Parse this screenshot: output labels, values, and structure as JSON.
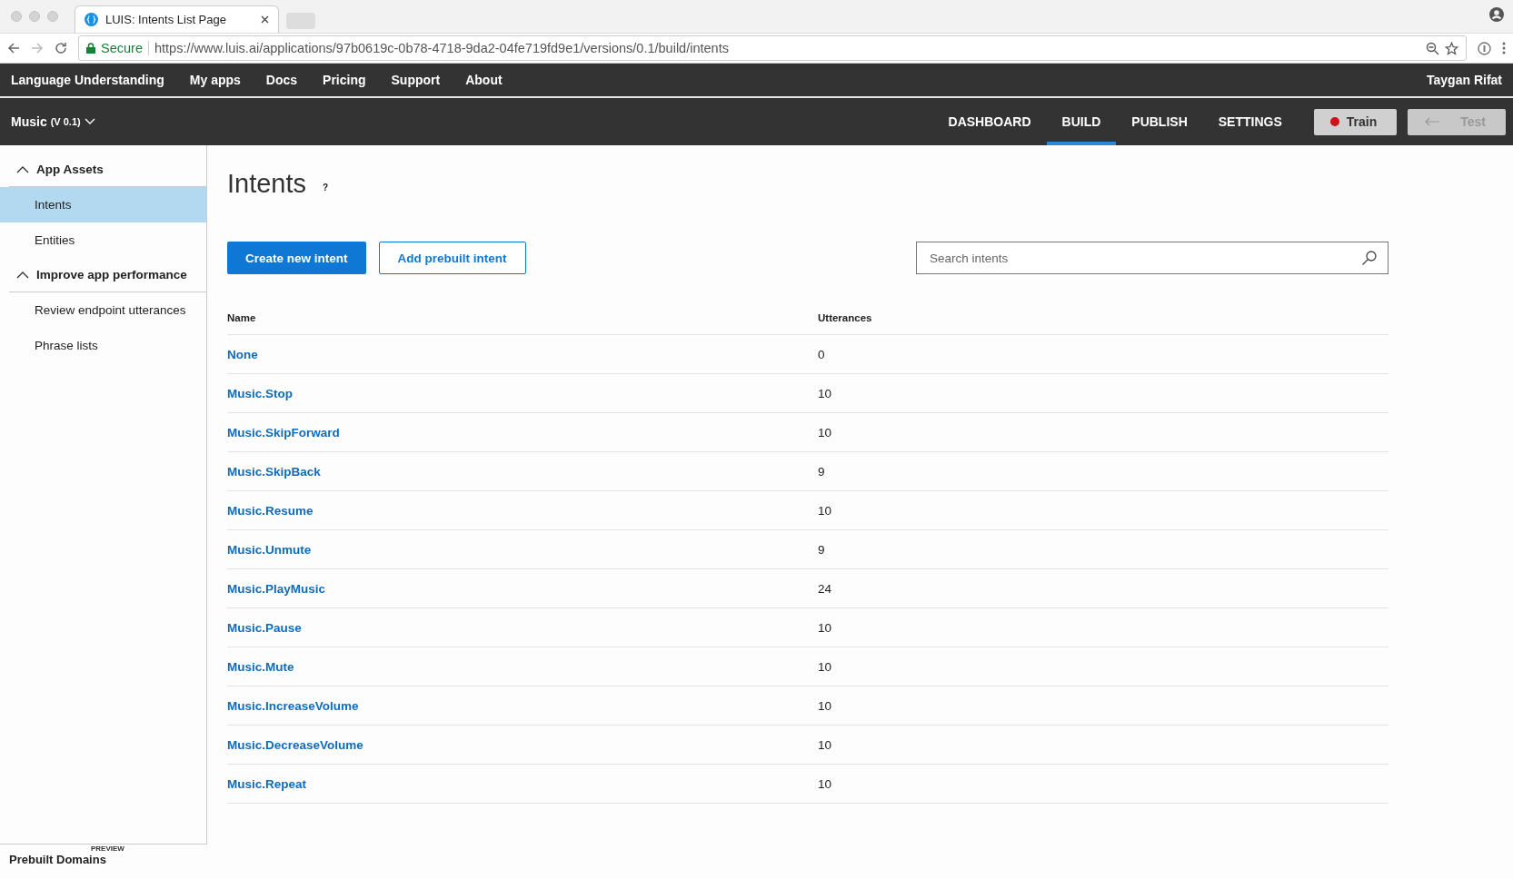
{
  "browser": {
    "tab_title": "LUIS: Intents List Page",
    "secure_label": "Secure",
    "url": "https://www.luis.ai/applications/97b0619c-0b78-4718-9da2-04fe719fd9e1/versions/0.1/build/intents"
  },
  "top_nav": {
    "items": [
      "Language Understanding",
      "My apps",
      "Docs",
      "Pricing",
      "Support",
      "About"
    ],
    "user": "Taygan Rifat"
  },
  "app_bar": {
    "app_name": "Music",
    "version": "(V 0.1)",
    "tabs": [
      {
        "label": "DASHBOARD",
        "selected": false
      },
      {
        "label": "BUILD",
        "selected": true
      },
      {
        "label": "PUBLISH",
        "selected": false
      },
      {
        "label": "SETTINGS",
        "selected": false
      }
    ],
    "train": {
      "label": "Train",
      "needs_training": true
    },
    "test": {
      "label": "Test",
      "disabled": true
    }
  },
  "sidebar": {
    "sections": [
      {
        "title": "App Assets",
        "expanded": true,
        "items": [
          {
            "label": "Intents",
            "selected": true
          },
          {
            "label": "Entities",
            "selected": false
          }
        ]
      },
      {
        "title": "Improve app performance",
        "expanded": true,
        "items": [
          {
            "label": "Review endpoint utterances",
            "selected": false
          },
          {
            "label": "Phrase lists",
            "selected": false
          }
        ]
      }
    ],
    "footer_badge": "PREVIEW",
    "footer_link": "Prebuilt Domains"
  },
  "main": {
    "title": "Intents",
    "help": "?",
    "primary_button": "Create new intent",
    "secondary_button": "Add prebuilt intent",
    "search": {
      "placeholder": "Search intents"
    },
    "table": {
      "columns": [
        "Name",
        "Utterances"
      ],
      "rows": [
        {
          "name": "None",
          "utterances": "0"
        },
        {
          "name": "Music.Stop",
          "utterances": "10"
        },
        {
          "name": "Music.SkipForward",
          "utterances": "10"
        },
        {
          "name": "Music.SkipBack",
          "utterances": "9"
        },
        {
          "name": "Music.Resume",
          "utterances": "10"
        },
        {
          "name": "Music.Unmute",
          "utterances": "9"
        },
        {
          "name": "Music.PlayMusic",
          "utterances": "24"
        },
        {
          "name": "Music.Pause",
          "utterances": "10"
        },
        {
          "name": "Music.Mute",
          "utterances": "10"
        },
        {
          "name": "Music.IncreaseVolume",
          "utterances": "10"
        },
        {
          "name": "Music.DecreaseVolume",
          "utterances": "10"
        },
        {
          "name": "Music.Repeat",
          "utterances": "10"
        }
      ]
    }
  }
}
